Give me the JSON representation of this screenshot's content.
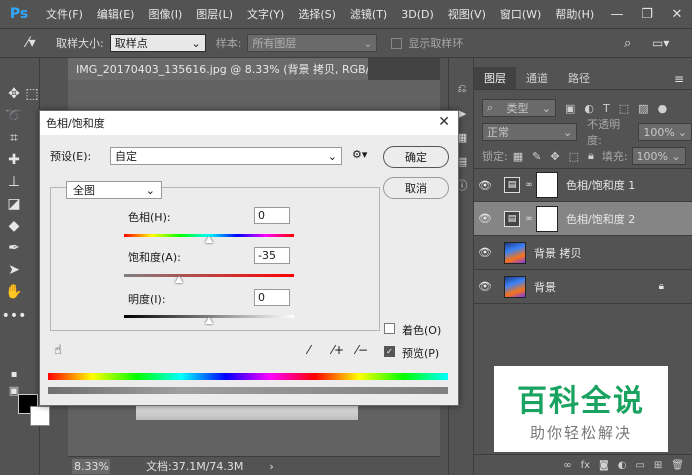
{
  "app": {
    "logo": "Ps"
  },
  "menu": [
    "文件(F)",
    "编辑(E)",
    "图像(I)",
    "图层(L)",
    "文字(Y)",
    "选择(S)",
    "滤镜(T)",
    "3D(D)",
    "视图(V)",
    "窗口(W)",
    "帮助(H)"
  ],
  "window_controls": {
    "minimize": "—",
    "restore": "❐",
    "close": "✕"
  },
  "options_bar": {
    "sample_size_label": "取样大小:",
    "sample_size_value": "取样点",
    "sample_label": "样本:",
    "sample_value": "所有图层",
    "show_ring_label": "显示取样环"
  },
  "document": {
    "tab_title": "IMG_20170403_135616.jpg @ 8.33% (背景 拷贝, RGB/8) *",
    "tab_close": "×",
    "zoom": "8.33%",
    "doc_size": "文档:37.1M/74.3M",
    "status_arrow": "›"
  },
  "layers_panel": {
    "tabs": [
      "图层",
      "通道",
      "路径"
    ],
    "filter_label": "类型",
    "blend_mode": "正常",
    "opacity_label": "不透明度:",
    "opacity_value": "100%",
    "lock_label": "锁定:",
    "fill_label": "填充:",
    "fill_value": "100%",
    "layers": [
      {
        "name": "色相/饱和度 1",
        "kind": "adjustment",
        "selected": false
      },
      {
        "name": "色相/饱和度 2",
        "kind": "adjustment",
        "selected": true
      },
      {
        "name": "背景 拷贝",
        "kind": "image",
        "selected": false
      },
      {
        "name": "背景",
        "kind": "image",
        "selected": false,
        "locked": true
      }
    ]
  },
  "dialog": {
    "title": "色相/饱和度",
    "close": "✕",
    "preset_label": "预设(E):",
    "preset_value": "自定",
    "ok_label": "确定",
    "cancel_label": "取消",
    "channel_value": "全图",
    "hue_label": "色相(H):",
    "hue_value": "0",
    "saturation_label": "饱和度(A):",
    "saturation_value": "-35",
    "lightness_label": "明度(I):",
    "lightness_value": "0",
    "colorize_label": "着色(O)",
    "preview_label": "预览(P)",
    "colorize_checked": false,
    "preview_checked": true
  },
  "watermark": {
    "title": "百科全说",
    "subtitle": "助你轻松解决"
  },
  "colors": {
    "accent_ps": "#31a8ff",
    "watermark_green": "#1aa260",
    "panel_bg": "#535353"
  }
}
